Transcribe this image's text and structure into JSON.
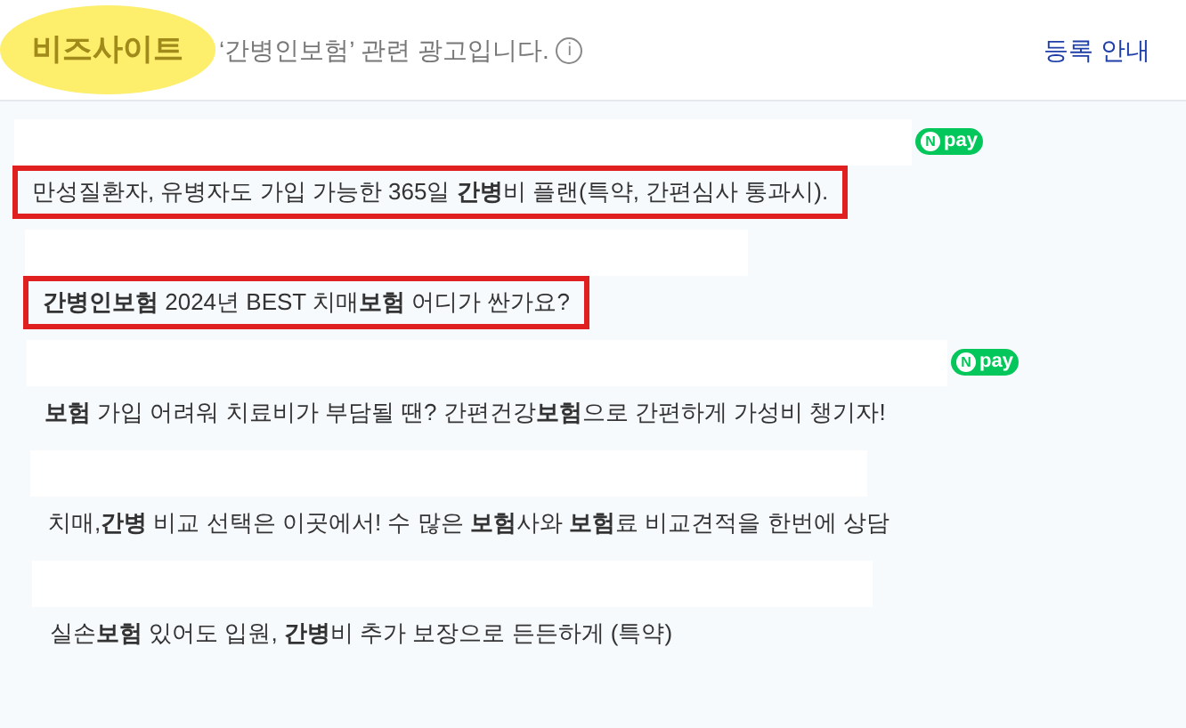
{
  "header": {
    "brand": "비즈사이트",
    "brand_highlighted": true,
    "notice": "‘간병인보험’ 관련 광고입니다.",
    "info_icon": "i",
    "register_link": "등록 안내"
  },
  "ads": [
    {
      "npay": {
        "mark": "N",
        "label": "pay"
      },
      "description": "만성질환자, 유병자도 가입 가능한 365일 **간병**비 플랜(특약, 간편심사 통과시).",
      "highlighted": true
    },
    {
      "description": "**간병인보험** 2024년 BEST 치매**보험** 어디가 싼가요?",
      "highlighted": true
    },
    {
      "npay": {
        "mark": "N",
        "label": "pay"
      },
      "description": "**보험** 가입 어려워 치료비가 부담될 땐? 간편건강**보험**으로 간편하게 가성비 챙기자!",
      "highlighted": false
    },
    {
      "description": "치매,**간병** 비교 선택은 이곳에서! 수 많은 **보험**사와 **보험**료 비교견적을 한번에 상담",
      "highlighted": false
    },
    {
      "description": "실손**보험** 있어도 입원, **간병**비 추가 보장으로 든든하게 (특약)",
      "highlighted": false
    }
  ]
}
